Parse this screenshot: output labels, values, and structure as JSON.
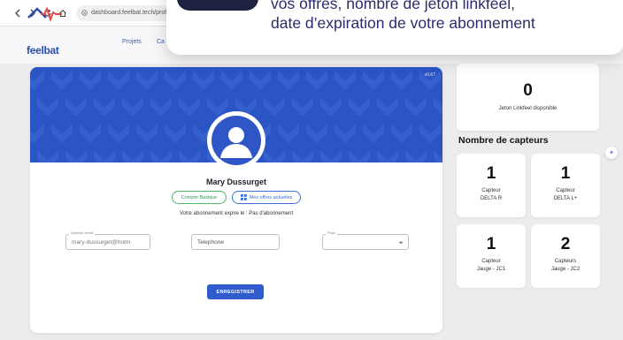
{
  "browser": {
    "url": "dashboard.feelbat.tech/profil"
  },
  "header": {
    "logo_text": "feelbat",
    "menu": [
      "Projets",
      "Ca"
    ]
  },
  "overlay": {
    "line1": "vos offres, nombre de jeton linkfeel,",
    "line2": "date d’expiration de votre abonnement"
  },
  "profile": {
    "version": "v0.67",
    "name": "Mary Dussurget",
    "chip_account": "Compte Basique",
    "chip_offers": "Mes offres actuelles",
    "subscription_text": "Votre abonnement expire le : Pas d'abonnement",
    "email_label": "Adresse email",
    "email_value": "mary-dussurget@hotm",
    "phone_placeholder": "Telephone",
    "country_label": "Pays",
    "country_value": "",
    "save_label": "ENREGISTRER"
  },
  "stats": {
    "token_value": "0",
    "token_label": "Jeton Linkfeel disponible",
    "sensors_title": "Nombre de capteurs",
    "sensors": [
      {
        "value": "1",
        "label1": "Capteur",
        "label2": "DELTA R"
      },
      {
        "value": "1",
        "label1": "Capteur",
        "label2": "DELTA L+"
      },
      {
        "value": "1",
        "label1": "Capteur",
        "label2": "Jauge - JC1"
      },
      {
        "value": "2",
        "label1": "Capteurs",
        "label2": "Jauge - JC2"
      }
    ]
  },
  "colors": {
    "brand_blue": "#2e56c6",
    "button_blue": "#2f5bcc",
    "chip_green": "#4cb56a",
    "overlay_text": "#2b2b6b"
  },
  "icons": {
    "side_handle": "sparkle-icon"
  }
}
